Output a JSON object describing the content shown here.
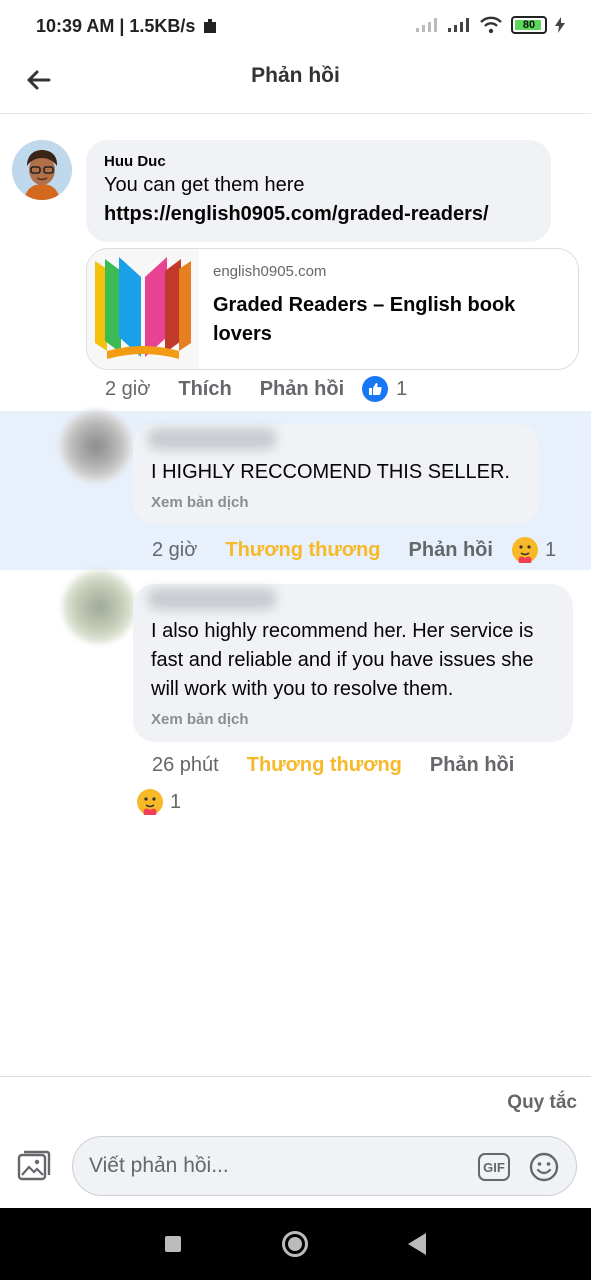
{
  "status_bar": {
    "time_speed": "10:39 AM | 1.5KB/s",
    "battery": "80"
  },
  "header": {
    "title": "Phản hồi"
  },
  "comments": [
    {
      "author": "Huu Duc",
      "text_plain": "You can get them here ",
      "text_link": "https://english0905.com/graded-readers/",
      "link_preview": {
        "domain": "english0905.com",
        "title": "Graded Readers – English book lovers"
      },
      "time": "2 giờ",
      "action": "Thích",
      "reply": "Phản hồi",
      "reaction_count": "1"
    },
    {
      "text": "I HIGHLY RECCOMEND THIS SELLER.",
      "translate": "Xem bản dịch",
      "time": "2 giờ",
      "action": "Thương thương",
      "reply": "Phản hồi",
      "reaction_count": "1"
    },
    {
      "text": "I also highly recommend her. Her service is fast and reliable and if you have issues she will work with you to resolve them.",
      "translate": "Xem bản dịch",
      "time": "26 phút",
      "action": "Thương thương",
      "reply": "Phản hồi",
      "reaction_count": "1"
    }
  ],
  "composer": {
    "rules": "Quy tắc",
    "placeholder": "Viết phản hồi...",
    "gif": "GIF"
  },
  "colors": {
    "care": "#f7b928",
    "like": "#1877f2",
    "highlight": "#e7f0fb",
    "bubble": "#f0f2f5"
  }
}
